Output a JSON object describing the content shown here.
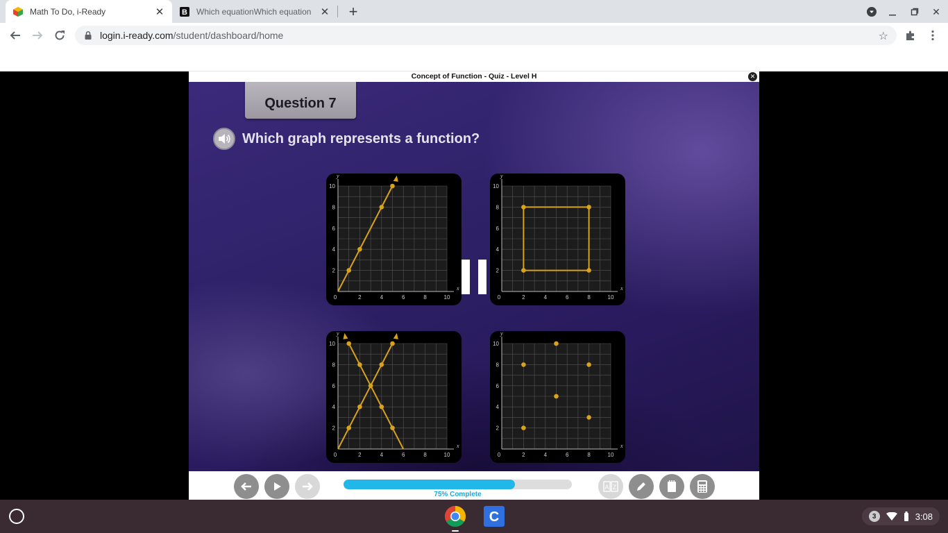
{
  "browser": {
    "tabs": [
      {
        "title": "Math To Do, i-Ready",
        "active": true,
        "favicon": "iready-cube-icon"
      },
      {
        "title": "Which equationWhich equation",
        "active": false,
        "favicon": "brainly-b-icon"
      }
    ],
    "url": "login.i-ready.com/student/dashboard/home",
    "url_host": "login.i-ready.com",
    "url_path": "/student/dashboard/home"
  },
  "quiz": {
    "window_title": "Concept of Function - Quiz - Level H",
    "question_label": "Question 7",
    "prompt": "Which graph represents a function?",
    "progress_value": 0.75,
    "progress_label": "75% Complete"
  },
  "graphs": {
    "axis_ticks": [
      "2",
      "4",
      "6",
      "8",
      "10"
    ],
    "origin_label": "0",
    "x_axis_label": "x",
    "y_axis_label": "y",
    "point_color": "#d9a21b",
    "options": [
      {
        "name": "line-graph",
        "lines": [
          [
            [
              0,
              0
            ],
            [
              5,
              10
            ]
          ]
        ],
        "points": [
          [
            1,
            2
          ],
          [
            2,
            4
          ],
          [
            4,
            8
          ],
          [
            5,
            10
          ]
        ],
        "arrow": [
          5.4,
          10.8
        ]
      },
      {
        "name": "square-graph",
        "lines": [
          [
            [
              2,
              2
            ],
            [
              2,
              8
            ]
          ],
          [
            [
              2,
              8
            ],
            [
              8,
              8
            ]
          ],
          [
            [
              8,
              8
            ],
            [
              8,
              2
            ]
          ],
          [
            [
              8,
              2
            ],
            [
              2,
              2
            ]
          ]
        ],
        "points": [
          [
            2,
            2
          ],
          [
            2,
            8
          ],
          [
            8,
            8
          ],
          [
            8,
            2
          ]
        ]
      },
      {
        "name": "x-graph",
        "lines": [
          [
            [
              0,
              0
            ],
            [
              5,
              10
            ]
          ],
          [
            [
              6,
              0
            ],
            [
              1,
              10
            ]
          ]
        ],
        "points": [
          [
            1,
            2
          ],
          [
            2,
            4
          ],
          [
            3,
            6
          ],
          [
            4,
            8
          ],
          [
            5,
            10
          ],
          [
            1,
            10
          ],
          [
            2,
            8
          ],
          [
            4,
            4
          ],
          [
            5,
            2
          ]
        ],
        "arrow": [
          5.4,
          10.8
        ],
        "arrow2": [
          0.6,
          10.8
        ]
      },
      {
        "name": "scatter-graph",
        "lines": [],
        "points": [
          [
            2,
            2
          ],
          [
            2,
            8
          ],
          [
            5,
            10
          ],
          [
            5,
            5
          ],
          [
            8,
            8
          ],
          [
            8,
            3
          ]
        ]
      }
    ]
  },
  "shelf": {
    "notification_count": "3",
    "time": "3:08"
  }
}
